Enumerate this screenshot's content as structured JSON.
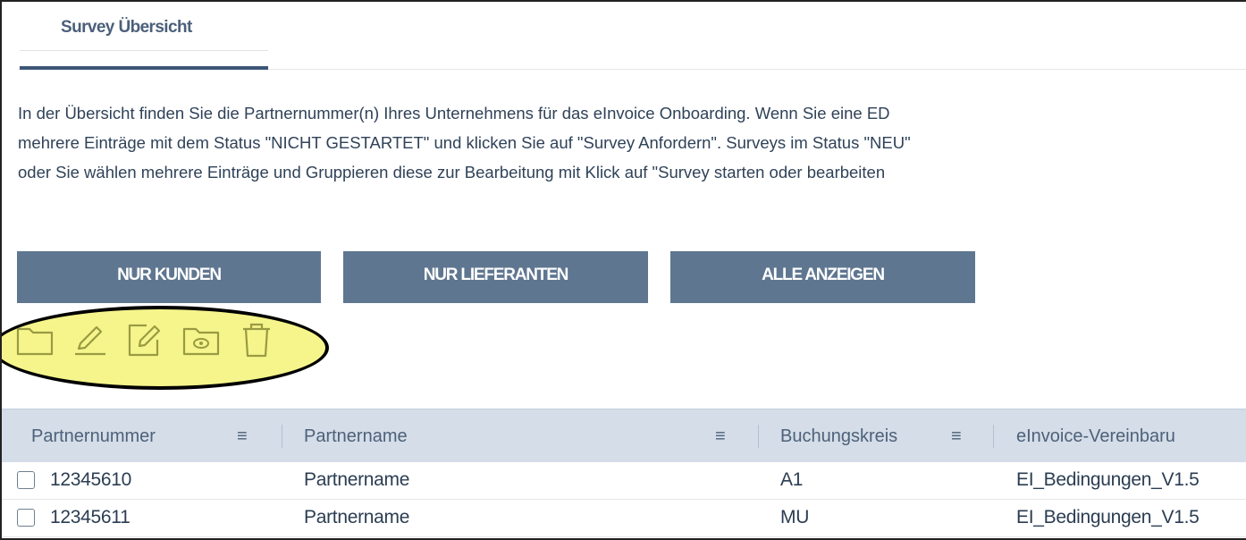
{
  "tabs": [
    {
      "label": "Survey Übersicht",
      "active": true
    }
  ],
  "intro": {
    "lines": [
      "In der Übersicht finden Sie die Partnernummer(n) Ihres Unternehmens für das eInvoice Onboarding. Wenn Sie eine ED",
      "mehrere Einträge mit dem Status \"NICHT GESTARTET\" und klicken Sie auf \"Survey Anfordern\". Surveys im Status \"NEU\"",
      "oder Sie wählen mehrere Einträge und Gruppieren diese zur Bearbeitung mit Klick auf \"Survey starten oder bearbeiten"
    ]
  },
  "filters": {
    "kunden": "NUR KUNDEN",
    "lieferanten": "NUR LIEFERANTEN",
    "alle": "ALLE ANZEIGEN"
  },
  "toolbar_icons": [
    "folder-icon",
    "pencil-icon",
    "edit-icon",
    "view-folder-icon",
    "trash-icon"
  ],
  "colors": {
    "accent": "#3d5677",
    "button_bg": "#5f7690",
    "header_bg": "#d4dde8",
    "highlight": "#f5f58c",
    "icon": "#9a9a43"
  },
  "table": {
    "columns": [
      "Partnernummer",
      "Partnername",
      "Buchungskreis",
      "eInvoice-Vereinbaru"
    ],
    "column_menu_icon": "≡",
    "rows": [
      {
        "partnernummer": "12345610",
        "partnername": "Partnername",
        "buchungskreis": "A1",
        "vereinbarung": "EI_Bedingungen_V1.5"
      },
      {
        "partnernummer": "12345611",
        "partnername": "Partnername",
        "buchungskreis": "MU",
        "vereinbarung": "EI_Bedingungen_V1.5"
      }
    ]
  }
}
